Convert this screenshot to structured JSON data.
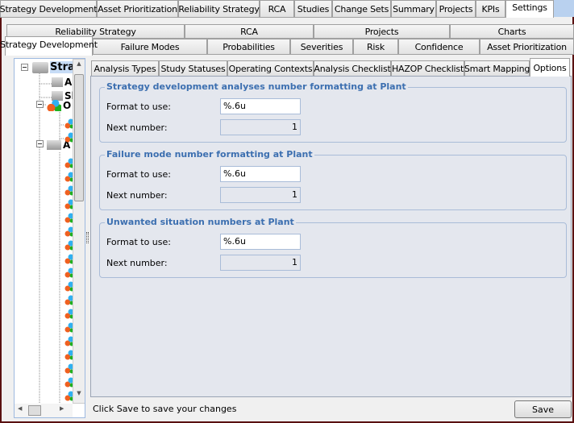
{
  "top_tabs": [
    "Strategy Development",
    "Asset Prioritization",
    "Reliability Strategy",
    "RCA",
    "Studies",
    "Change Sets",
    "Summary",
    "Projects",
    "KPIs",
    "Settings"
  ],
  "settings_tabs_row1": [
    "Reliability Strategy",
    "RCA",
    "Projects",
    "Charts"
  ],
  "settings_tabs_row2": [
    "Strategy Development",
    "Failure Modes",
    "Probabilities",
    "Severities",
    "Risk",
    "Confidence",
    "Asset Prioritization"
  ],
  "sub_tabs": [
    "Analysis Types",
    "Study Statuses",
    "Operating Contexts",
    "Analysis Checklist",
    "HAZOP Checklist",
    "Smart Mapping",
    "Options"
  ],
  "tree": {
    "root": "Stra",
    "items": [
      "A",
      "Sl",
      "O",
      "A"
    ]
  },
  "groups": [
    {
      "title": "Strategy development analyses number formatting at Plant",
      "format_label": "Format to use:",
      "format_value": "%.6u",
      "next_label": "Next number:",
      "next_value": "1"
    },
    {
      "title": "Failure mode number formatting at Plant",
      "format_label": "Format to use:",
      "format_value": "%.6u",
      "next_label": "Next number:",
      "next_value": "1"
    },
    {
      "title": "Unwanted situation numbers at Plant",
      "format_label": "Format to use:",
      "format_value": "%.6u",
      "next_label": "Next number:",
      "next_value": "1"
    }
  ],
  "status_text": "Click Save to save your changes",
  "save_label": "Save"
}
